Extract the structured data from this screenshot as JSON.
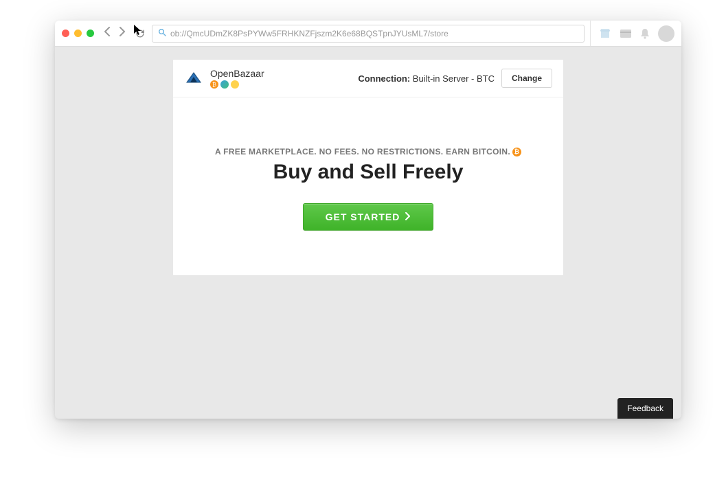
{
  "address": {
    "url": "ob://QmcUDmZK8PsPYWw5FRHKNZFjszm2K6e68BQSTpnJYUsML7/store"
  },
  "brand": {
    "name": "OpenBazaar"
  },
  "connection": {
    "label": "Connection:",
    "value": "Built-in Server - BTC",
    "change_label": "Change"
  },
  "hero": {
    "tagline": "A FREE MARKETPLACE. NO FEES. NO RESTRICTIONS. EARN BITCOIN.",
    "headline": "Buy and Sell Freely",
    "cta_label": "GET STARTED"
  },
  "feedback": {
    "label": "Feedback"
  }
}
